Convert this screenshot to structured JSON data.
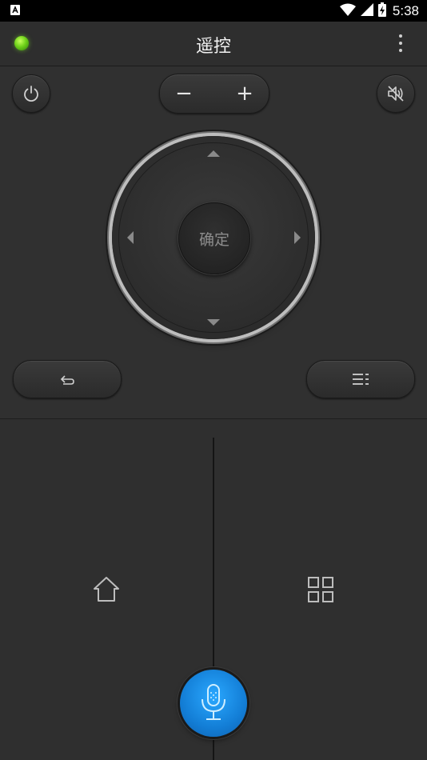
{
  "status_bar": {
    "time": "5:38"
  },
  "app_bar": {
    "title": "遥控",
    "menu_icon": "more-vert-icon",
    "indicator_color": "#6fd21a"
  },
  "remote": {
    "power_icon": "power-icon",
    "volume_down_label": "−",
    "volume_up_label": "+",
    "mute_icon": "volume-mute-icon",
    "ok_label": "确定",
    "back_icon": "back-icon",
    "menu_icon": "menu-list-icon"
  },
  "bottom": {
    "home_icon": "home-icon",
    "apps_icon": "apps-grid-icon",
    "mic_icon": "microphone-icon",
    "mic_color": "#137ed6"
  }
}
